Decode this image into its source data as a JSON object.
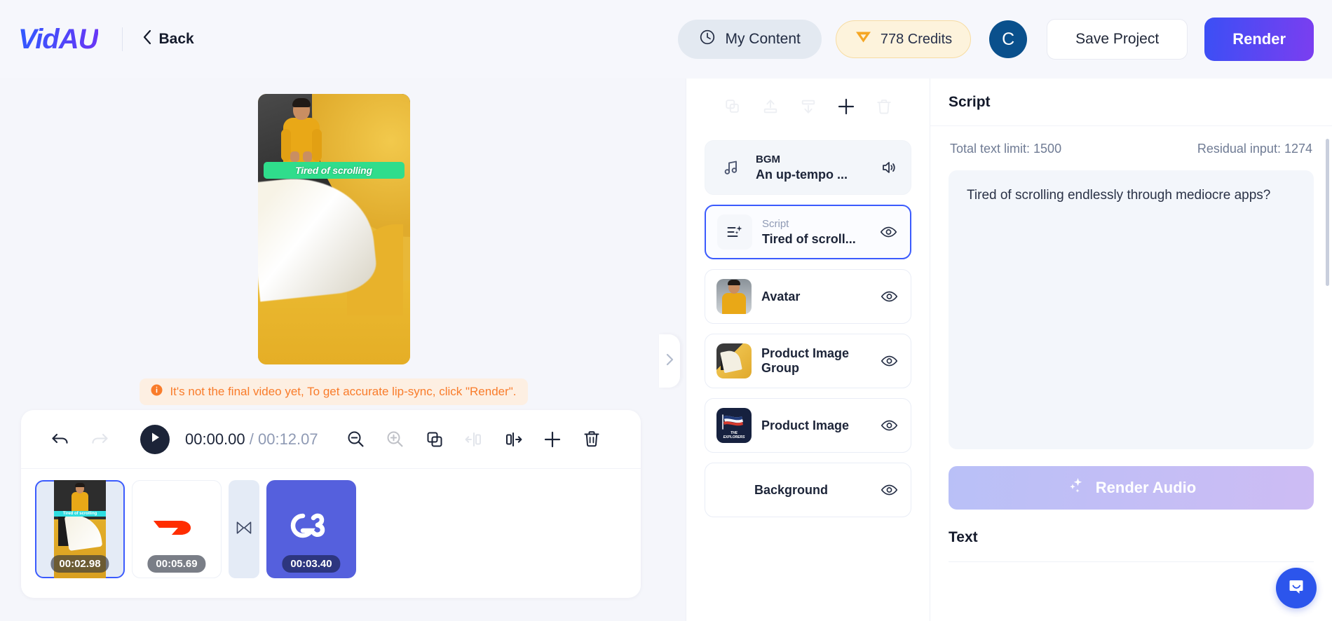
{
  "header": {
    "logo": "VidAU",
    "back_label": "Back",
    "back_icon": "chevron-left-icon",
    "my_content_label": "My Content",
    "my_content_icon": "clock-icon",
    "credits_label": "778 Credits",
    "credits_icon": "diamond-icon",
    "avatar_initial": "C",
    "save_project_label": "Save Project",
    "render_label": "Render",
    "accent_color": "#3b4ff5",
    "credits_bg": "#fdf3dc",
    "avatar_bg": "#0a508c"
  },
  "preview": {
    "caption": "Tired of scrolling",
    "caption_bg": "#2fdd8c",
    "notice": "It's not the final video yet, To get accurate lip-sync, click \"Render\".",
    "notice_icon": "info-icon",
    "notice_color": "#f97c2b"
  },
  "timeline": {
    "undo_icon": "undo-icon",
    "redo_icon": "redo-icon",
    "play_icon": "play-icon",
    "current_time": "00:00.00",
    "separator": " / ",
    "total_time": "00:12.07",
    "tools": [
      {
        "name": "zoom-out-icon",
        "enabled": true
      },
      {
        "name": "zoom-in-icon",
        "enabled": false
      },
      {
        "name": "duplicate-icon",
        "enabled": true
      },
      {
        "name": "split-left-icon",
        "enabled": false
      },
      {
        "name": "split-right-icon",
        "enabled": true
      },
      {
        "name": "add-icon",
        "enabled": true
      },
      {
        "name": "delete-icon",
        "enabled": true
      }
    ],
    "clips": [
      {
        "duration": "00:02.98",
        "selected": true,
        "kind": "avatar-scene",
        "caption": "Tired of scrolling"
      },
      {
        "duration": "00:05.69",
        "selected": false,
        "kind": "doordash-logo"
      },
      {
        "duration": "",
        "selected": false,
        "kind": "transition"
      },
      {
        "duration": "00:03.40",
        "selected": false,
        "kind": "g3-logo"
      }
    ]
  },
  "layers_panel": {
    "collapse_icon": "chevron-right-icon",
    "toolbar": [
      {
        "name": "duplicate-layer-icon",
        "enabled": false
      },
      {
        "name": "bring-forward-icon",
        "enabled": false
      },
      {
        "name": "send-backward-icon",
        "enabled": false
      },
      {
        "name": "add-layer-icon",
        "enabled": true
      },
      {
        "name": "delete-layer-icon",
        "enabled": false
      }
    ],
    "items": [
      {
        "sub": "BGM",
        "title": "An up-tempo ...",
        "icon": "music-note-icon",
        "action_icon": "volume-icon",
        "active": false,
        "style": "bgm"
      },
      {
        "sub": "Script",
        "title": "Tired of scroll...",
        "icon": "script-sparkle-icon",
        "action_icon": "eye-icon",
        "active": true,
        "style": "icon"
      },
      {
        "sub": "",
        "title": "Avatar",
        "icon": "avatar-thumbnail",
        "action_icon": "eye-icon",
        "active": false,
        "style": "thumb-avatar"
      },
      {
        "sub": "",
        "title": "Product Image Group",
        "icon": "product-image-group-thumbnail",
        "action_icon": "eye-icon",
        "active": false,
        "style": "thumb-pig"
      },
      {
        "sub": "",
        "title": "Product Image",
        "icon": "product-image-thumbnail",
        "action_icon": "eye-icon",
        "active": false,
        "style": "thumb-exp",
        "thumb_text_1": "THE",
        "thumb_text_2": "EXPLORERS"
      },
      {
        "sub": "",
        "title": "Background",
        "icon": "",
        "action_icon": "eye-icon",
        "active": false,
        "style": "none"
      }
    ]
  },
  "script_panel": {
    "title": "Script",
    "total_limit": "Total text limit: 1500",
    "residual": "Residual input: 1274",
    "script_text": "Tired of scrolling endlessly through mediocre apps?",
    "render_audio_label": "Render Audio",
    "render_audio_icon": "sparkle-icon",
    "text_section_title": "Text",
    "chat_icon": "chat-bubble-icon"
  }
}
